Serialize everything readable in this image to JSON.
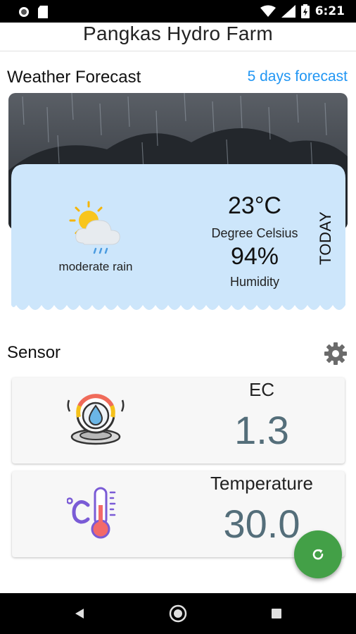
{
  "status_bar": {
    "time": "6:21"
  },
  "app": {
    "title": "Pangkas Hydro Farm"
  },
  "weather": {
    "section_title": "Weather Forecast",
    "forecast_link": "5 days forecast",
    "temperature": "23°C",
    "temperature_label": "Degree Celsius",
    "humidity": "94%",
    "humidity_label": "Humidity",
    "condition": "moderate rain",
    "day_label": "TODAY",
    "card_color": "#cde6fb"
  },
  "sensor": {
    "section_title": "Sensor",
    "cards": [
      {
        "label": "EC",
        "value": "1.3",
        "icon": "water-drop-sensor-icon"
      },
      {
        "label": "Temperature",
        "value": "30.0",
        "icon": "thermometer-icon"
      }
    ]
  },
  "colors": {
    "accent": "#2196f3",
    "fab": "#43a047",
    "value_text": "#546e7a"
  }
}
